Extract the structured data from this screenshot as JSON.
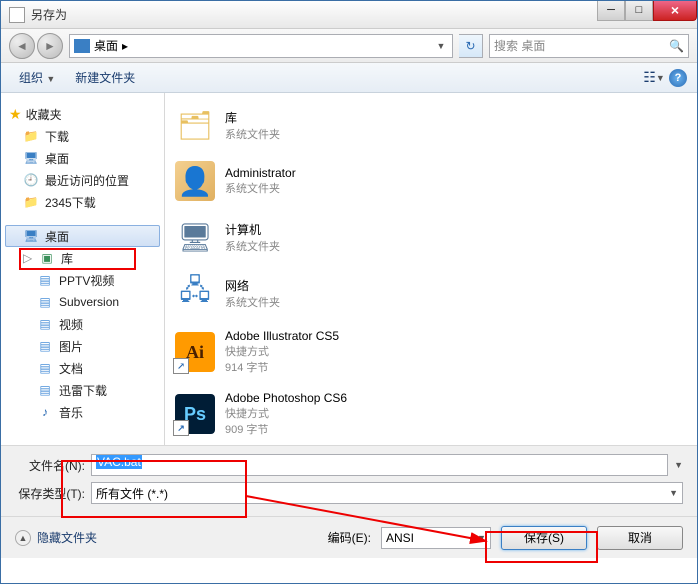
{
  "title": "另存为",
  "breadcrumb": {
    "location": "桌面",
    "arrow": "▸"
  },
  "search": {
    "placeholder": "搜索 桌面"
  },
  "toolbar": {
    "organize": "组织",
    "newfolder": "新建文件夹"
  },
  "sidebar": {
    "favorites": {
      "label": "收藏夹",
      "items": [
        {
          "label": "下载"
        },
        {
          "label": "桌面"
        },
        {
          "label": "最近访问的位置"
        },
        {
          "label": "2345下载"
        }
      ]
    },
    "desktop": "桌面",
    "library": {
      "label": "库",
      "items": [
        {
          "label": "PPTV视频"
        },
        {
          "label": "Subversion"
        },
        {
          "label": "视频"
        },
        {
          "label": "图片"
        },
        {
          "label": "文档"
        },
        {
          "label": "迅雷下载"
        },
        {
          "label": "音乐"
        }
      ]
    }
  },
  "content": [
    {
      "name": "库",
      "sub": "系统文件夹",
      "icon": "lib"
    },
    {
      "name": "Administrator",
      "sub": "系统文件夹",
      "icon": "user"
    },
    {
      "name": "计算机",
      "sub": "系统文件夹",
      "icon": "comp"
    },
    {
      "name": "网络",
      "sub": "系统文件夹",
      "icon": "net"
    },
    {
      "name": "Adobe Illustrator CS5",
      "sub": "快捷方式",
      "sub2": "914 字节",
      "icon": "ai"
    },
    {
      "name": "Adobe Photoshop CS6",
      "sub": "快捷方式",
      "sub2": "909 字节",
      "icon": "ps"
    }
  ],
  "form": {
    "filename_label": "文件名(N):",
    "filename_value": "VAC.bat",
    "filetype_label": "保存类型(T):",
    "filetype_value": "所有文件  (*.*)"
  },
  "footer": {
    "hide_folders": "隐藏文件夹",
    "encoding_label": "编码(E):",
    "encoding_value": "ANSI",
    "save": "保存(S)",
    "cancel": "取消"
  }
}
